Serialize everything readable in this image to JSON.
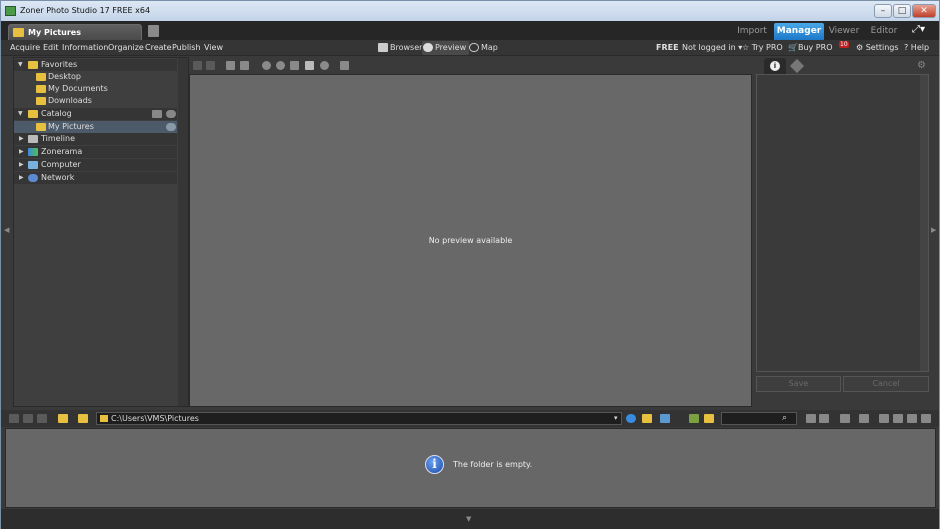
{
  "window": {
    "title": "Zoner Photo Studio 17 FREE x64",
    "min": "–",
    "max": "□",
    "close": "✕"
  },
  "doc_tab": {
    "label": "My Pictures"
  },
  "modes": {
    "import": "Import",
    "manager": "Manager",
    "viewer": "Viewer",
    "editor": "Editor"
  },
  "menu": [
    "Acquire",
    "Edit",
    "Information",
    "Organize",
    "Create",
    "Publish",
    "View"
  ],
  "views": {
    "browser": "Browser",
    "preview": "Preview",
    "map": "Map"
  },
  "account": {
    "edition": "FREE",
    "login": "Not logged in",
    "try_pro": "Try PRO",
    "buy_pro": "Buy PRO",
    "badge": "10",
    "settings": "Settings",
    "help": "Help"
  },
  "tree": {
    "favorites": "Favorites",
    "desktop": "Desktop",
    "my_documents": "My Documents",
    "downloads": "Downloads",
    "catalog": "Catalog",
    "my_pictures": "My Pictures",
    "timeline": "Timeline",
    "zonerama": "Zonerama",
    "computer": "Computer",
    "network": "Network"
  },
  "preview": {
    "message": "No preview available"
  },
  "right_panel": {
    "save": "Save",
    "cancel": "Cancel"
  },
  "address": {
    "path": "C:\\Users\\VMS\\Pictures"
  },
  "browser": {
    "message": "The folder is empty."
  },
  "colors": {
    "accent": "#1d78c8",
    "folder": "#e8c040",
    "panel": "#3f3f3f",
    "preview_bg": "#686868"
  }
}
